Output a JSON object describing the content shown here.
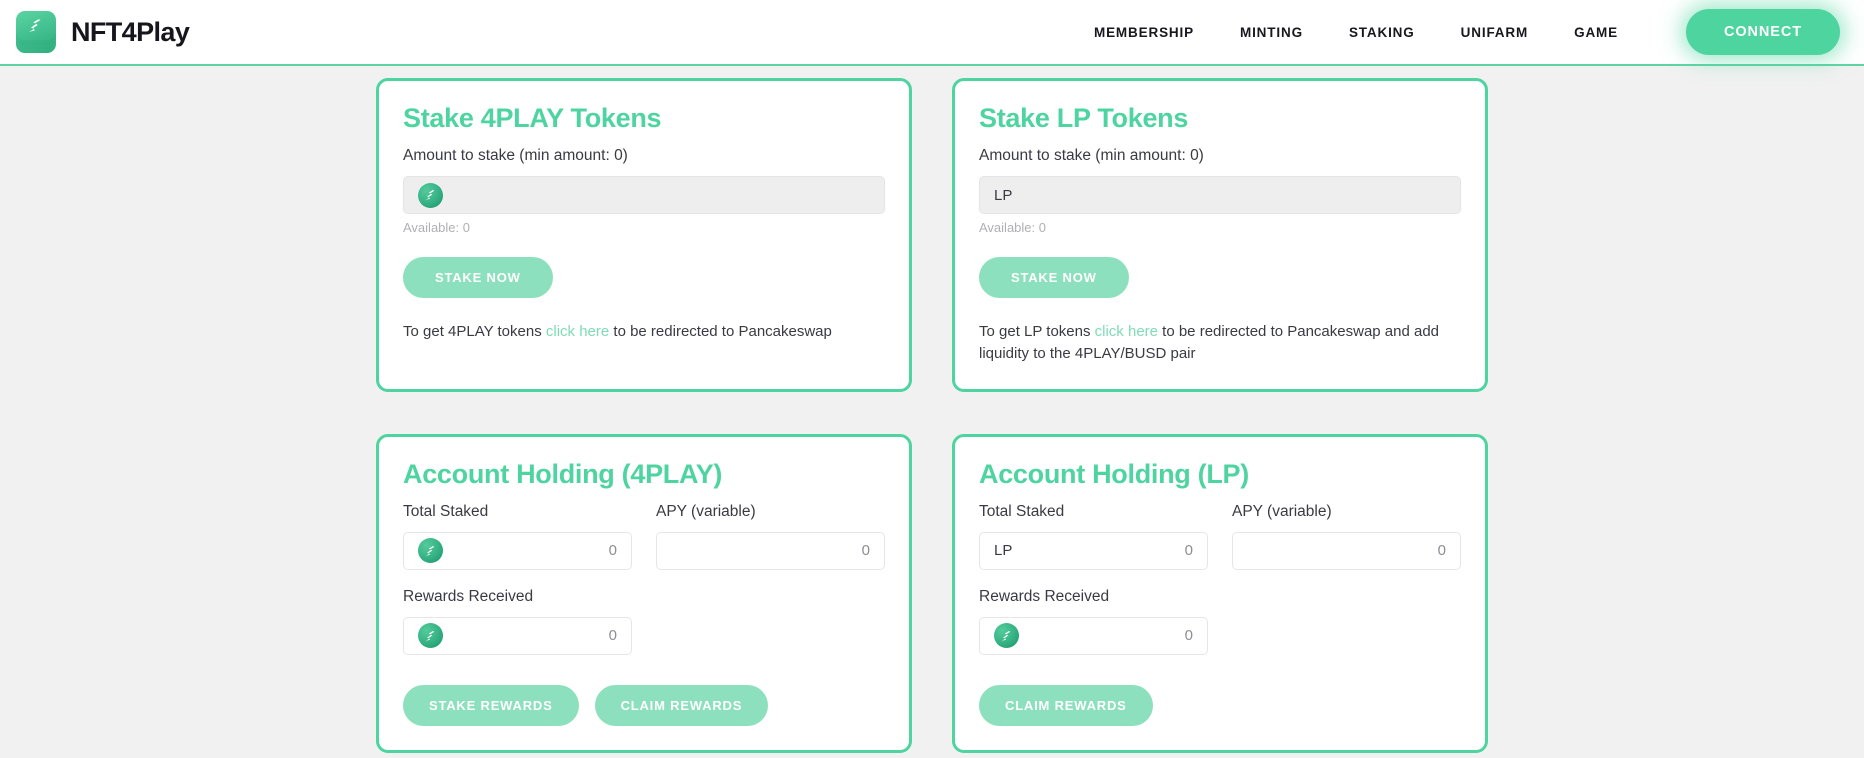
{
  "header": {
    "brand_name": "NFT4Play",
    "logo_icon": "nft4play-stack-logo",
    "nav": [
      {
        "label": "MEMBERSHIP",
        "name": "nav-link-membership"
      },
      {
        "label": "MINTING",
        "name": "nav-link-minting"
      },
      {
        "label": "STAKING",
        "name": "nav-link-staking"
      },
      {
        "label": "UNIFARM",
        "name": "nav-link-unifarm"
      },
      {
        "label": "GAME",
        "name": "nav-link-game"
      }
    ],
    "connect_label": "CONNECT"
  },
  "colors": {
    "brand_green": "#4ed4a0",
    "button_muted_green": "#8ce0bd",
    "connect_green": "#4dd49f",
    "page_background": "#f1f1f1",
    "link_green": "#7fdcb6"
  },
  "stake_4play": {
    "title": "Stake 4PLAY Tokens",
    "amount_label": "Amount to stake (min amount: 0)",
    "input_value": "",
    "input_placeholder": "",
    "token_icon": "4play-token-icon",
    "available": "Available: 0",
    "stake_button": "STAKE NOW",
    "help_prefix": "To get 4PLAY tokens ",
    "help_link": "click here",
    "help_suffix": " to be redirected to Pancakeswap"
  },
  "stake_lp": {
    "title": "Stake LP Tokens",
    "amount_label": "Amount to stake (min amount: 0)",
    "input_value": "LP",
    "input_placeholder": "LP",
    "available": "Available: 0",
    "stake_button": "STAKE NOW",
    "help_prefix": "To get LP tokens ",
    "help_link": "click here",
    "help_suffix": " to be redirected to Pancakeswap and add liquidity to the 4PLAY/BUSD pair"
  },
  "holding_4play": {
    "title": "Account Holding (4PLAY)",
    "total_staked_label": "Total Staked",
    "total_staked_value": "0",
    "total_staked_icon": "4play-token-icon",
    "apy_label": "APY (variable)",
    "apy_value": "0",
    "rewards_label": "Rewards Received",
    "rewards_value": "0",
    "rewards_icon": "4play-token-icon",
    "stake_rewards_button": "STAKE REWARDS",
    "claim_rewards_button": "CLAIM REWARDS"
  },
  "holding_lp": {
    "title": "Account Holding (LP)",
    "total_staked_label": "Total Staked",
    "total_staked_prefix": "LP",
    "total_staked_value": "0",
    "apy_label": "APY (variable)",
    "apy_value": "0",
    "rewards_label": "Rewards Received",
    "rewards_value": "0",
    "rewards_icon": "4play-token-icon",
    "claim_rewards_button": "CLAIM REWARDS"
  }
}
